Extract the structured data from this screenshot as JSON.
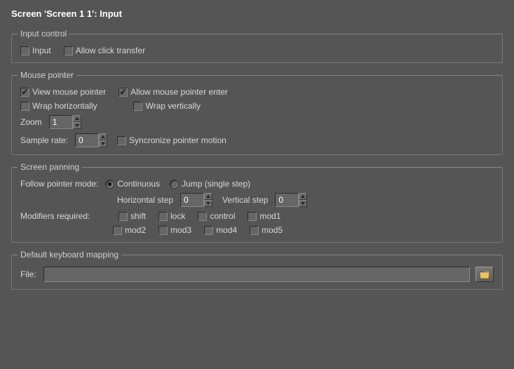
{
  "title": "Screen 'Screen 1 1': Input",
  "groups": {
    "input_control": {
      "legend": "Input control",
      "input_label": "Input",
      "allow_click_transfer_label": "Allow click transfer"
    },
    "mouse_pointer": {
      "legend": "Mouse pointer",
      "view_label": "View mouse pointer",
      "allow_enter_label": "Allow mouse pointer enter",
      "wrap_h_label": "Wrap horizontally",
      "wrap_v_label": "Wrap vertically",
      "zoom_label": "Zoom",
      "zoom_value": "1",
      "sample_rate_label": "Sample rate:",
      "sample_rate_value": "0",
      "sync_label": "Syncronize pointer motion"
    },
    "screen_panning": {
      "legend": "Screen panning",
      "follow_label": "Follow pointer mode:",
      "continuous_label": "Continuous",
      "jump_label": "Jump (single step)",
      "hstep_label": "Horizontal step",
      "hstep_value": "0",
      "vstep_label": "Vertical step",
      "vstep_value": "0",
      "modifiers_label": "Modifiers required:",
      "shift_label": "shift",
      "lock_label": "lock",
      "control_label": "control",
      "mod1_label": "mod1",
      "mod2_label": "mod2",
      "mod3_label": "mod3",
      "mod4_label": "mod4",
      "mod5_label": "mod5"
    },
    "keyboard": {
      "legend": "Default keyboard mapping",
      "file_label": "File:",
      "file_value": ""
    }
  }
}
